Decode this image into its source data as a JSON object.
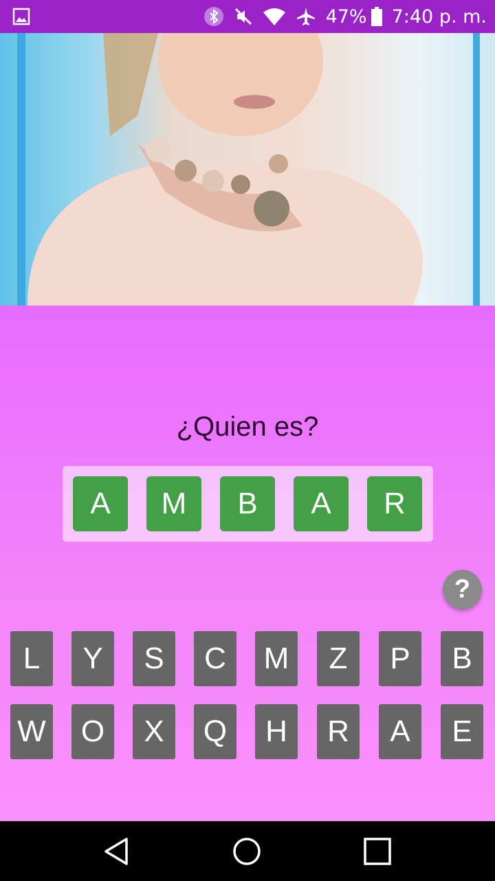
{
  "status_bar": {
    "battery_percent": "47%",
    "time": "7:40 p. m.",
    "icons": [
      "image-notification-icon",
      "bluetooth-icon",
      "mute-icon",
      "wifi-icon",
      "airplane-icon",
      "battery-icon"
    ]
  },
  "colors": {
    "status_bar": "#9a23c8",
    "game_top": "#e66cff",
    "game_bottom": "#fa90fb",
    "answer_tile": "#43a047",
    "key": "#666666",
    "hint": "#8a8a8a"
  },
  "game": {
    "question": "¿Quien es?",
    "answer_letters": [
      "A",
      "M",
      "B",
      "A",
      "R"
    ],
    "keyboard_rows": [
      [
        "L",
        "Y",
        "S",
        "C",
        "M",
        "Z",
        "P",
        "B"
      ],
      [
        "W",
        "O",
        "X",
        "Q",
        "H",
        "R",
        "A",
        "E"
      ]
    ],
    "hint_label": "?"
  },
  "nav_bar": {
    "buttons": [
      "back-icon",
      "home-icon",
      "recents-icon"
    ]
  }
}
